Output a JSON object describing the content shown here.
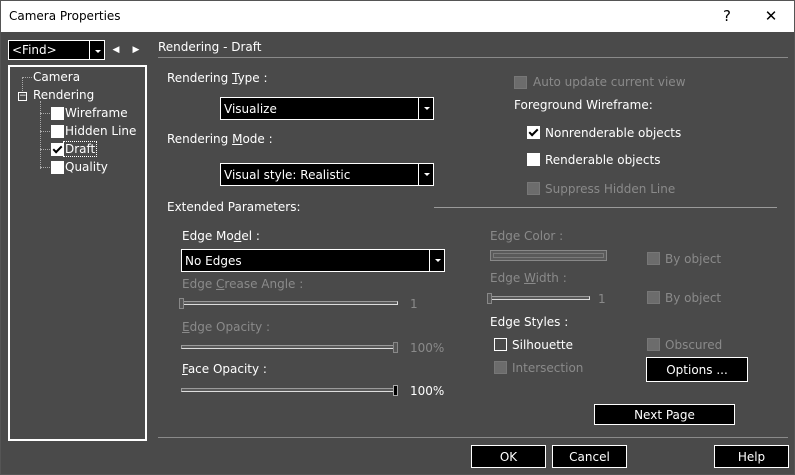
{
  "window": {
    "title": "Camera Properties",
    "help_glyph": "?",
    "close_glyph": "✕"
  },
  "find": {
    "value": "<Find>"
  },
  "tree": {
    "items": [
      {
        "label": "Camera"
      },
      {
        "label": "Rendering",
        "toggle": "−"
      },
      {
        "label": "Wireframe",
        "checked": false
      },
      {
        "label": "Hidden Line",
        "checked": false
      },
      {
        "label": "Draft",
        "checked": true
      },
      {
        "label": "Quality",
        "checked": false
      }
    ]
  },
  "panel": {
    "heading": "Rendering - Draft"
  },
  "rendering_type": {
    "label_prefix": "Rendering ",
    "label_hot": "T",
    "label_suffix": "ype :",
    "value": "Visualize"
  },
  "rendering_mode": {
    "label_prefix": "Rendering ",
    "label_hot": "M",
    "label_suffix": "ode :",
    "value": "Visual style: Realistic"
  },
  "auto_update": {
    "label": "Auto update current view",
    "checked": false,
    "disabled": true
  },
  "foreground_wireframe": {
    "label": "Foreground Wireframe:",
    "nonrenderable": {
      "label": "Nonrenderable objects",
      "checked": true
    },
    "renderable": {
      "label": "Renderable objects",
      "checked": false
    },
    "suppress": {
      "label": "Suppress Hidden Line",
      "checked": false,
      "disabled": true
    }
  },
  "extended": {
    "label": "Extended Parameters:"
  },
  "edge_model": {
    "label_prefix": "Edge Mo",
    "label_hot": "d",
    "label_suffix": "el :",
    "value": "No Edges"
  },
  "edge_crease": {
    "label_prefix": "Edge ",
    "label_hot": "C",
    "label_suffix": "rease Angle :",
    "value": "1"
  },
  "edge_opacity": {
    "label_hot": "E",
    "label_suffix": "dge Opacity :",
    "value": "100%"
  },
  "face_opacity": {
    "label_hot": "F",
    "label_suffix": "ace Opacity :",
    "value": "100%"
  },
  "edge_color": {
    "label": "Edge Color :",
    "by_object": "By object"
  },
  "edge_width": {
    "label_prefix": "Edge ",
    "label_hot": "W",
    "label_suffix": "idth :",
    "value": "1",
    "by_object": "By object"
  },
  "edge_styles": {
    "label": "Edge Styles :",
    "silhouette": {
      "label": "Silhouette",
      "checked": false
    },
    "obscured": {
      "label": "Obscured",
      "checked": false,
      "disabled": true
    },
    "intersection": {
      "label": "Intersection",
      "checked": false,
      "disabled": true
    },
    "options_label": "Options ..."
  },
  "buttons": {
    "next_page": "Next Page",
    "ok": "OK",
    "cancel": "Cancel",
    "help": "Help"
  },
  "nav": {
    "back_glyph": "◀",
    "forward_glyph": "▶"
  }
}
